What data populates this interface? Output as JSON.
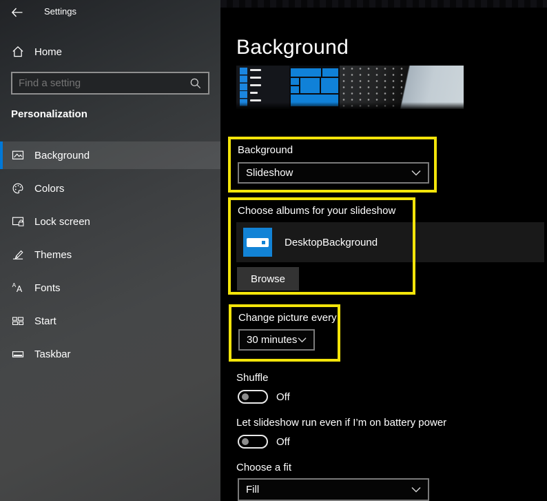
{
  "window": {
    "title": "Settings"
  },
  "sidebar": {
    "home_label": "Home",
    "search_placeholder": "Find a setting",
    "section_header": "Personalization",
    "items": [
      {
        "label": "Background",
        "icon": "picture-icon",
        "selected": true
      },
      {
        "label": "Colors",
        "icon": "palette-icon",
        "selected": false
      },
      {
        "label": "Lock screen",
        "icon": "lock-screen-icon",
        "selected": false
      },
      {
        "label": "Themes",
        "icon": "themes-icon",
        "selected": false
      },
      {
        "label": "Fonts",
        "icon": "fonts-icon",
        "selected": false
      },
      {
        "label": "Start",
        "icon": "start-tiles-icon",
        "selected": false
      },
      {
        "label": "Taskbar",
        "icon": "taskbar-icon",
        "selected": false
      }
    ]
  },
  "main": {
    "page_title": "Background",
    "background_dropdown": {
      "label": "Background",
      "value": "Slideshow"
    },
    "albums_section": {
      "label": "Choose albums for your slideshow",
      "album_name": "DesktopBackground",
      "browse_button": "Browse"
    },
    "change_picture": {
      "label": "Change picture every",
      "value": "30 minutes"
    },
    "shuffle_toggle": {
      "label": "Shuffle",
      "state": "Off"
    },
    "battery_toggle": {
      "label": "Let slideshow run even if I’m on battery power",
      "state": "Off"
    },
    "fit_dropdown": {
      "label": "Choose a fit",
      "value": "Fill"
    }
  },
  "colors": {
    "accent_blue": "#0078d7",
    "highlight_yellow": "#f3e40a",
    "tile_blue": "#1081d8",
    "album_icon_blue": "#1283d6"
  }
}
